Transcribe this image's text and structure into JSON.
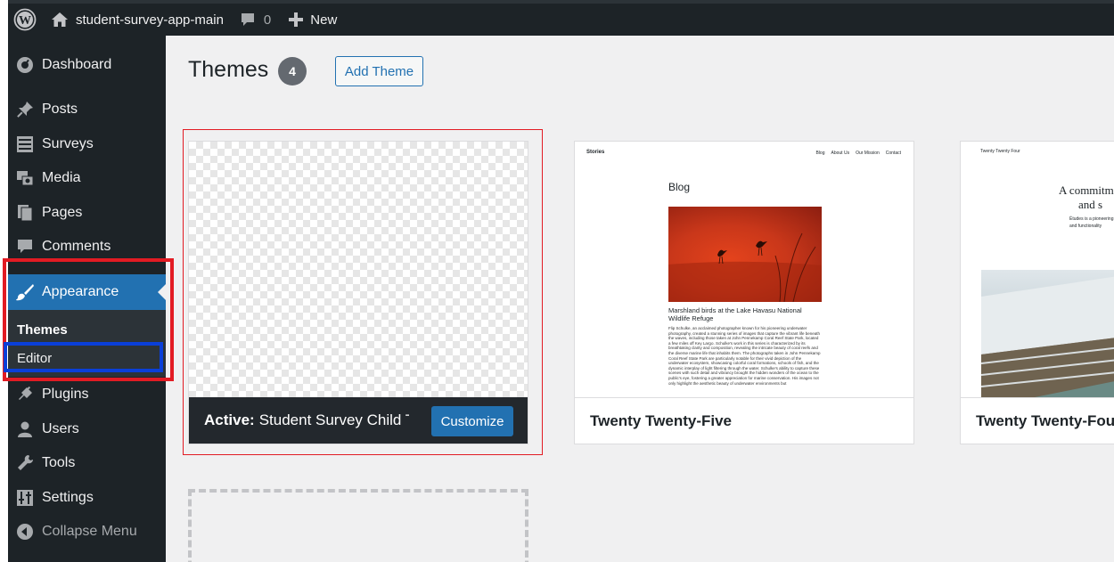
{
  "admin_bar": {
    "site_name": "student-survey-app-main",
    "comments_count": "0",
    "new_label": "New"
  },
  "sidebar": {
    "items": [
      {
        "label": "Dashboard",
        "icon": "dashboard-icon"
      },
      {
        "label": "Posts",
        "icon": "pin-icon"
      },
      {
        "label": "Surveys",
        "icon": "list-icon"
      },
      {
        "label": "Media",
        "icon": "media-icon"
      },
      {
        "label": "Pages",
        "icon": "pages-icon"
      },
      {
        "label": "Comments",
        "icon": "comment-icon"
      },
      {
        "label": "Appearance",
        "icon": "paintbrush-icon"
      },
      {
        "label": "Plugins",
        "icon": "plug-icon"
      },
      {
        "label": "Users",
        "icon": "user-icon"
      },
      {
        "label": "Tools",
        "icon": "wrench-icon"
      },
      {
        "label": "Settings",
        "icon": "settings-icon"
      }
    ],
    "submenu": [
      "Themes",
      "Editor"
    ],
    "collapse_label": "Collapse Menu"
  },
  "main": {
    "title": "Themes",
    "count": "4",
    "add_button": "Add Theme"
  },
  "themes": [
    {
      "active_prefix": "Active:",
      "name": "Student Survey Child Th...",
      "customize_label": "Customize"
    },
    {
      "name": "Twenty Twenty-Five"
    },
    {
      "name": "Twenty Twenty-Four"
    }
  ],
  "preview_tt5": {
    "brand": "Stories",
    "nav": [
      "Blog",
      "About Us",
      "Our Mission",
      "Contact"
    ],
    "heading": "Blog",
    "caption": "Marshland birds at the Lake Havasu National Wildlife Refuge",
    "body": "Flip Schulke, an acclaimed photographer known for his pioneering underwater photography, created a stunning series of images that capture the vibrant life beneath the waves, including those taken at John Pennekamp Coral Reef State Park, located a few miles off Key Largo. Schulke's work in this series is characterized by its breathtaking clarity and composition, revealing the intricate beauty of coral reefs and the diverse marine life that inhabits them. The photographs taken in John Pennekamp Coral Reef State Park are particularly notable for their vivid depiction of the underwater ecosystem, showcasing colorful coral formations, schools of fish, and the dynamic interplay of light filtering through the water. Schulke's ability to capture these scenes with such detail and vibrancy brought the hidden wonders of the ocean to the public's eye, fostering a greater appreciation for marine conservation. His images not only highlight the aesthetic beauty of underwater environments but"
  },
  "preview_tt4": {
    "back": "Twenty Twenty Four",
    "title_line1": "A commitm",
    "title_line2": "and s",
    "sub_line1": "Études is a pioneering",
    "sub_line2": "and functionality"
  },
  "colors": {
    "admin_dark": "#1d2327",
    "accent": "#2271b1",
    "highlight_red": "#e21b23",
    "highlight_blue": "#0a3fd8"
  }
}
